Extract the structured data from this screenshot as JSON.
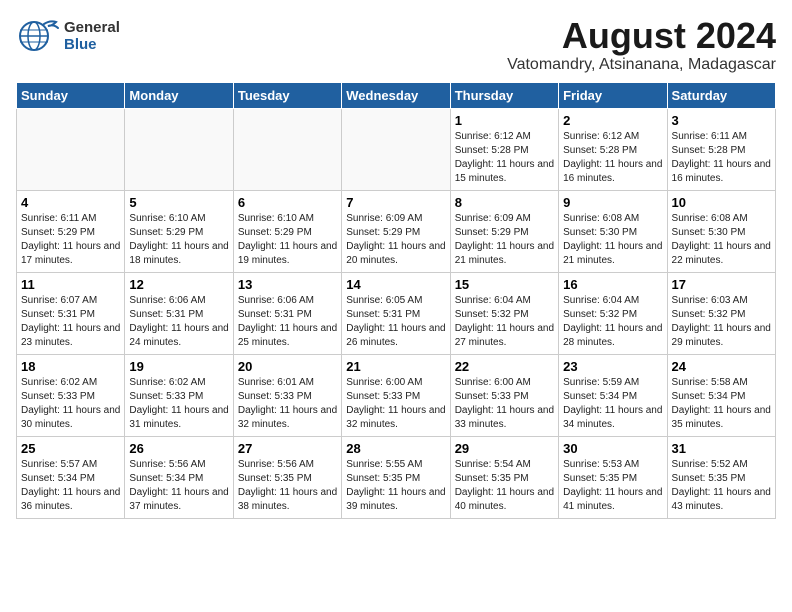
{
  "logo": {
    "general": "General",
    "blue": "Blue"
  },
  "title": "August 2024",
  "subtitle": "Vatomandry, Atsinanana, Madagascar",
  "days_of_week": [
    "Sunday",
    "Monday",
    "Tuesday",
    "Wednesday",
    "Thursday",
    "Friday",
    "Saturday"
  ],
  "weeks": [
    [
      {
        "day": "",
        "sunrise": "",
        "sunset": "",
        "daylight": "",
        "empty": true
      },
      {
        "day": "",
        "sunrise": "",
        "sunset": "",
        "daylight": "",
        "empty": true
      },
      {
        "day": "",
        "sunrise": "",
        "sunset": "",
        "daylight": "",
        "empty": true
      },
      {
        "day": "",
        "sunrise": "",
        "sunset": "",
        "daylight": "",
        "empty": true
      },
      {
        "day": "1",
        "sunrise": "Sunrise: 6:12 AM",
        "sunset": "Sunset: 5:28 PM",
        "daylight": "Daylight: 11 hours and 15 minutes.",
        "empty": false
      },
      {
        "day": "2",
        "sunrise": "Sunrise: 6:12 AM",
        "sunset": "Sunset: 5:28 PM",
        "daylight": "Daylight: 11 hours and 16 minutes.",
        "empty": false
      },
      {
        "day": "3",
        "sunrise": "Sunrise: 6:11 AM",
        "sunset": "Sunset: 5:28 PM",
        "daylight": "Daylight: 11 hours and 16 minutes.",
        "empty": false
      }
    ],
    [
      {
        "day": "4",
        "sunrise": "Sunrise: 6:11 AM",
        "sunset": "Sunset: 5:29 PM",
        "daylight": "Daylight: 11 hours and 17 minutes.",
        "empty": false
      },
      {
        "day": "5",
        "sunrise": "Sunrise: 6:10 AM",
        "sunset": "Sunset: 5:29 PM",
        "daylight": "Daylight: 11 hours and 18 minutes.",
        "empty": false
      },
      {
        "day": "6",
        "sunrise": "Sunrise: 6:10 AM",
        "sunset": "Sunset: 5:29 PM",
        "daylight": "Daylight: 11 hours and 19 minutes.",
        "empty": false
      },
      {
        "day": "7",
        "sunrise": "Sunrise: 6:09 AM",
        "sunset": "Sunset: 5:29 PM",
        "daylight": "Daylight: 11 hours and 20 minutes.",
        "empty": false
      },
      {
        "day": "8",
        "sunrise": "Sunrise: 6:09 AM",
        "sunset": "Sunset: 5:29 PM",
        "daylight": "Daylight: 11 hours and 21 minutes.",
        "empty": false
      },
      {
        "day": "9",
        "sunrise": "Sunrise: 6:08 AM",
        "sunset": "Sunset: 5:30 PM",
        "daylight": "Daylight: 11 hours and 21 minutes.",
        "empty": false
      },
      {
        "day": "10",
        "sunrise": "Sunrise: 6:08 AM",
        "sunset": "Sunset: 5:30 PM",
        "daylight": "Daylight: 11 hours and 22 minutes.",
        "empty": false
      }
    ],
    [
      {
        "day": "11",
        "sunrise": "Sunrise: 6:07 AM",
        "sunset": "Sunset: 5:31 PM",
        "daylight": "Daylight: 11 hours and 23 minutes.",
        "empty": false
      },
      {
        "day": "12",
        "sunrise": "Sunrise: 6:06 AM",
        "sunset": "Sunset: 5:31 PM",
        "daylight": "Daylight: 11 hours and 24 minutes.",
        "empty": false
      },
      {
        "day": "13",
        "sunrise": "Sunrise: 6:06 AM",
        "sunset": "Sunset: 5:31 PM",
        "daylight": "Daylight: 11 hours and 25 minutes.",
        "empty": false
      },
      {
        "day": "14",
        "sunrise": "Sunrise: 6:05 AM",
        "sunset": "Sunset: 5:31 PM",
        "daylight": "Daylight: 11 hours and 26 minutes.",
        "empty": false
      },
      {
        "day": "15",
        "sunrise": "Sunrise: 6:04 AM",
        "sunset": "Sunset: 5:32 PM",
        "daylight": "Daylight: 11 hours and 27 minutes.",
        "empty": false
      },
      {
        "day": "16",
        "sunrise": "Sunrise: 6:04 AM",
        "sunset": "Sunset: 5:32 PM",
        "daylight": "Daylight: 11 hours and 28 minutes.",
        "empty": false
      },
      {
        "day": "17",
        "sunrise": "Sunrise: 6:03 AM",
        "sunset": "Sunset: 5:32 PM",
        "daylight": "Daylight: 11 hours and 29 minutes.",
        "empty": false
      }
    ],
    [
      {
        "day": "18",
        "sunrise": "Sunrise: 6:02 AM",
        "sunset": "Sunset: 5:33 PM",
        "daylight": "Daylight: 11 hours and 30 minutes.",
        "empty": false
      },
      {
        "day": "19",
        "sunrise": "Sunrise: 6:02 AM",
        "sunset": "Sunset: 5:33 PM",
        "daylight": "Daylight: 11 hours and 31 minutes.",
        "empty": false
      },
      {
        "day": "20",
        "sunrise": "Sunrise: 6:01 AM",
        "sunset": "Sunset: 5:33 PM",
        "daylight": "Daylight: 11 hours and 32 minutes.",
        "empty": false
      },
      {
        "day": "21",
        "sunrise": "Sunrise: 6:00 AM",
        "sunset": "Sunset: 5:33 PM",
        "daylight": "Daylight: 11 hours and 32 minutes.",
        "empty": false
      },
      {
        "day": "22",
        "sunrise": "Sunrise: 6:00 AM",
        "sunset": "Sunset: 5:33 PM",
        "daylight": "Daylight: 11 hours and 33 minutes.",
        "empty": false
      },
      {
        "day": "23",
        "sunrise": "Sunrise: 5:59 AM",
        "sunset": "Sunset: 5:34 PM",
        "daylight": "Daylight: 11 hours and 34 minutes.",
        "empty": false
      },
      {
        "day": "24",
        "sunrise": "Sunrise: 5:58 AM",
        "sunset": "Sunset: 5:34 PM",
        "daylight": "Daylight: 11 hours and 35 minutes.",
        "empty": false
      }
    ],
    [
      {
        "day": "25",
        "sunrise": "Sunrise: 5:57 AM",
        "sunset": "Sunset: 5:34 PM",
        "daylight": "Daylight: 11 hours and 36 minutes.",
        "empty": false
      },
      {
        "day": "26",
        "sunrise": "Sunrise: 5:56 AM",
        "sunset": "Sunset: 5:34 PM",
        "daylight": "Daylight: 11 hours and 37 minutes.",
        "empty": false
      },
      {
        "day": "27",
        "sunrise": "Sunrise: 5:56 AM",
        "sunset": "Sunset: 5:35 PM",
        "daylight": "Daylight: 11 hours and 38 minutes.",
        "empty": false
      },
      {
        "day": "28",
        "sunrise": "Sunrise: 5:55 AM",
        "sunset": "Sunset: 5:35 PM",
        "daylight": "Daylight: 11 hours and 39 minutes.",
        "empty": false
      },
      {
        "day": "29",
        "sunrise": "Sunrise: 5:54 AM",
        "sunset": "Sunset: 5:35 PM",
        "daylight": "Daylight: 11 hours and 40 minutes.",
        "empty": false
      },
      {
        "day": "30",
        "sunrise": "Sunrise: 5:53 AM",
        "sunset": "Sunset: 5:35 PM",
        "daylight": "Daylight: 11 hours and 41 minutes.",
        "empty": false
      },
      {
        "day": "31",
        "sunrise": "Sunrise: 5:52 AM",
        "sunset": "Sunset: 5:35 PM",
        "daylight": "Daylight: 11 hours and 43 minutes.",
        "empty": false
      }
    ]
  ]
}
